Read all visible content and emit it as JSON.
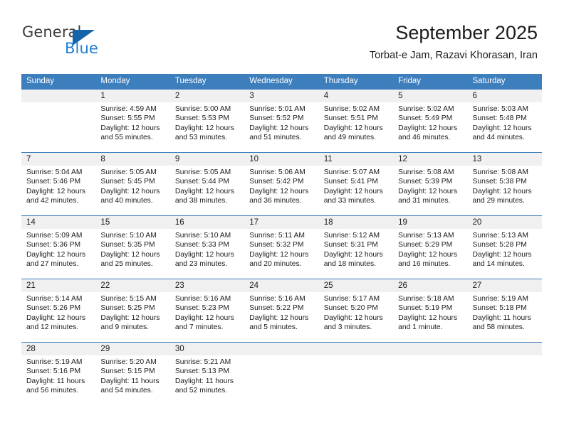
{
  "brand": {
    "name_top": "General",
    "name_bottom": "Blue"
  },
  "header": {
    "title": "September 2025",
    "location": "Torbat-e Jam, Razavi Khorasan, Iran"
  },
  "colors": {
    "header_blue": "#3d7ebd",
    "brand_blue": "#1f7fd0",
    "brand_triangle": "#1463ab",
    "daynum_band": "#f0f0f0",
    "text": "#1c1c1c"
  },
  "weekdays": [
    "Sunday",
    "Monday",
    "Tuesday",
    "Wednesday",
    "Thursday",
    "Friday",
    "Saturday"
  ],
  "weeks": [
    [
      {
        "day": "",
        "sunrise": "",
        "sunset": "",
        "daylight": "",
        "empty": true
      },
      {
        "day": "1",
        "sunrise": "Sunrise: 4:59 AM",
        "sunset": "Sunset: 5:55 PM",
        "daylight": "Daylight: 12 hours and 55 minutes."
      },
      {
        "day": "2",
        "sunrise": "Sunrise: 5:00 AM",
        "sunset": "Sunset: 5:53 PM",
        "daylight": "Daylight: 12 hours and 53 minutes."
      },
      {
        "day": "3",
        "sunrise": "Sunrise: 5:01 AM",
        "sunset": "Sunset: 5:52 PM",
        "daylight": "Daylight: 12 hours and 51 minutes."
      },
      {
        "day": "4",
        "sunrise": "Sunrise: 5:02 AM",
        "sunset": "Sunset: 5:51 PM",
        "daylight": "Daylight: 12 hours and 49 minutes."
      },
      {
        "day": "5",
        "sunrise": "Sunrise: 5:02 AM",
        "sunset": "Sunset: 5:49 PM",
        "daylight": "Daylight: 12 hours and 46 minutes."
      },
      {
        "day": "6",
        "sunrise": "Sunrise: 5:03 AM",
        "sunset": "Sunset: 5:48 PM",
        "daylight": "Daylight: 12 hours and 44 minutes."
      }
    ],
    [
      {
        "day": "7",
        "sunrise": "Sunrise: 5:04 AM",
        "sunset": "Sunset: 5:46 PM",
        "daylight": "Daylight: 12 hours and 42 minutes."
      },
      {
        "day": "8",
        "sunrise": "Sunrise: 5:05 AM",
        "sunset": "Sunset: 5:45 PM",
        "daylight": "Daylight: 12 hours and 40 minutes."
      },
      {
        "day": "9",
        "sunrise": "Sunrise: 5:05 AM",
        "sunset": "Sunset: 5:44 PM",
        "daylight": "Daylight: 12 hours and 38 minutes."
      },
      {
        "day": "10",
        "sunrise": "Sunrise: 5:06 AM",
        "sunset": "Sunset: 5:42 PM",
        "daylight": "Daylight: 12 hours and 36 minutes."
      },
      {
        "day": "11",
        "sunrise": "Sunrise: 5:07 AM",
        "sunset": "Sunset: 5:41 PM",
        "daylight": "Daylight: 12 hours and 33 minutes."
      },
      {
        "day": "12",
        "sunrise": "Sunrise: 5:08 AM",
        "sunset": "Sunset: 5:39 PM",
        "daylight": "Daylight: 12 hours and 31 minutes."
      },
      {
        "day": "13",
        "sunrise": "Sunrise: 5:08 AM",
        "sunset": "Sunset: 5:38 PM",
        "daylight": "Daylight: 12 hours and 29 minutes."
      }
    ],
    [
      {
        "day": "14",
        "sunrise": "Sunrise: 5:09 AM",
        "sunset": "Sunset: 5:36 PM",
        "daylight": "Daylight: 12 hours and 27 minutes."
      },
      {
        "day": "15",
        "sunrise": "Sunrise: 5:10 AM",
        "sunset": "Sunset: 5:35 PM",
        "daylight": "Daylight: 12 hours and 25 minutes."
      },
      {
        "day": "16",
        "sunrise": "Sunrise: 5:10 AM",
        "sunset": "Sunset: 5:33 PM",
        "daylight": "Daylight: 12 hours and 23 minutes."
      },
      {
        "day": "17",
        "sunrise": "Sunrise: 5:11 AM",
        "sunset": "Sunset: 5:32 PM",
        "daylight": "Daylight: 12 hours and 20 minutes."
      },
      {
        "day": "18",
        "sunrise": "Sunrise: 5:12 AM",
        "sunset": "Sunset: 5:31 PM",
        "daylight": "Daylight: 12 hours and 18 minutes."
      },
      {
        "day": "19",
        "sunrise": "Sunrise: 5:13 AM",
        "sunset": "Sunset: 5:29 PM",
        "daylight": "Daylight: 12 hours and 16 minutes."
      },
      {
        "day": "20",
        "sunrise": "Sunrise: 5:13 AM",
        "sunset": "Sunset: 5:28 PM",
        "daylight": "Daylight: 12 hours and 14 minutes."
      }
    ],
    [
      {
        "day": "21",
        "sunrise": "Sunrise: 5:14 AM",
        "sunset": "Sunset: 5:26 PM",
        "daylight": "Daylight: 12 hours and 12 minutes."
      },
      {
        "day": "22",
        "sunrise": "Sunrise: 5:15 AM",
        "sunset": "Sunset: 5:25 PM",
        "daylight": "Daylight: 12 hours and 9 minutes."
      },
      {
        "day": "23",
        "sunrise": "Sunrise: 5:16 AM",
        "sunset": "Sunset: 5:23 PM",
        "daylight": "Daylight: 12 hours and 7 minutes."
      },
      {
        "day": "24",
        "sunrise": "Sunrise: 5:16 AM",
        "sunset": "Sunset: 5:22 PM",
        "daylight": "Daylight: 12 hours and 5 minutes."
      },
      {
        "day": "25",
        "sunrise": "Sunrise: 5:17 AM",
        "sunset": "Sunset: 5:20 PM",
        "daylight": "Daylight: 12 hours and 3 minutes."
      },
      {
        "day": "26",
        "sunrise": "Sunrise: 5:18 AM",
        "sunset": "Sunset: 5:19 PM",
        "daylight": "Daylight: 12 hours and 1 minute."
      },
      {
        "day": "27",
        "sunrise": "Sunrise: 5:19 AM",
        "sunset": "Sunset: 5:18 PM",
        "daylight": "Daylight: 11 hours and 58 minutes."
      }
    ],
    [
      {
        "day": "28",
        "sunrise": "Sunrise: 5:19 AM",
        "sunset": "Sunset: 5:16 PM",
        "daylight": "Daylight: 11 hours and 56 minutes."
      },
      {
        "day": "29",
        "sunrise": "Sunrise: 5:20 AM",
        "sunset": "Sunset: 5:15 PM",
        "daylight": "Daylight: 11 hours and 54 minutes."
      },
      {
        "day": "30",
        "sunrise": "Sunrise: 5:21 AM",
        "sunset": "Sunset: 5:13 PM",
        "daylight": "Daylight: 11 hours and 52 minutes."
      },
      {
        "day": "",
        "sunrise": "",
        "sunset": "",
        "daylight": "",
        "empty": true
      },
      {
        "day": "",
        "sunrise": "",
        "sunset": "",
        "daylight": "",
        "empty": true
      },
      {
        "day": "",
        "sunrise": "",
        "sunset": "",
        "daylight": "",
        "empty": true
      },
      {
        "day": "",
        "sunrise": "",
        "sunset": "",
        "daylight": "",
        "empty": true
      }
    ]
  ]
}
